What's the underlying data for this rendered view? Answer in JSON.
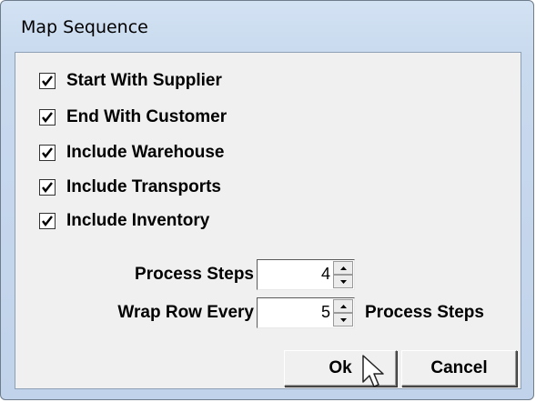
{
  "window": {
    "title": "Map Sequence"
  },
  "options": [
    {
      "label": "Start With Supplier",
      "checked": true
    },
    {
      "label": "End With Customer",
      "checked": true
    },
    {
      "label": "Include Warehouse",
      "checked": true
    },
    {
      "label": "Include Transports",
      "checked": true
    },
    {
      "label": "Include Inventory",
      "checked": true
    }
  ],
  "process_steps": {
    "label": "Process Steps",
    "value": "4"
  },
  "wrap_row": {
    "label": "Wrap Row Every",
    "value": "5",
    "suffix": "Process Steps"
  },
  "buttons": {
    "ok": "Ok",
    "cancel": "Cancel"
  },
  "icons": {
    "check": "check-icon",
    "spin_up": "arrow-up-icon",
    "spin_down": "arrow-down-icon",
    "cursor": "mouse-pointer-icon"
  }
}
